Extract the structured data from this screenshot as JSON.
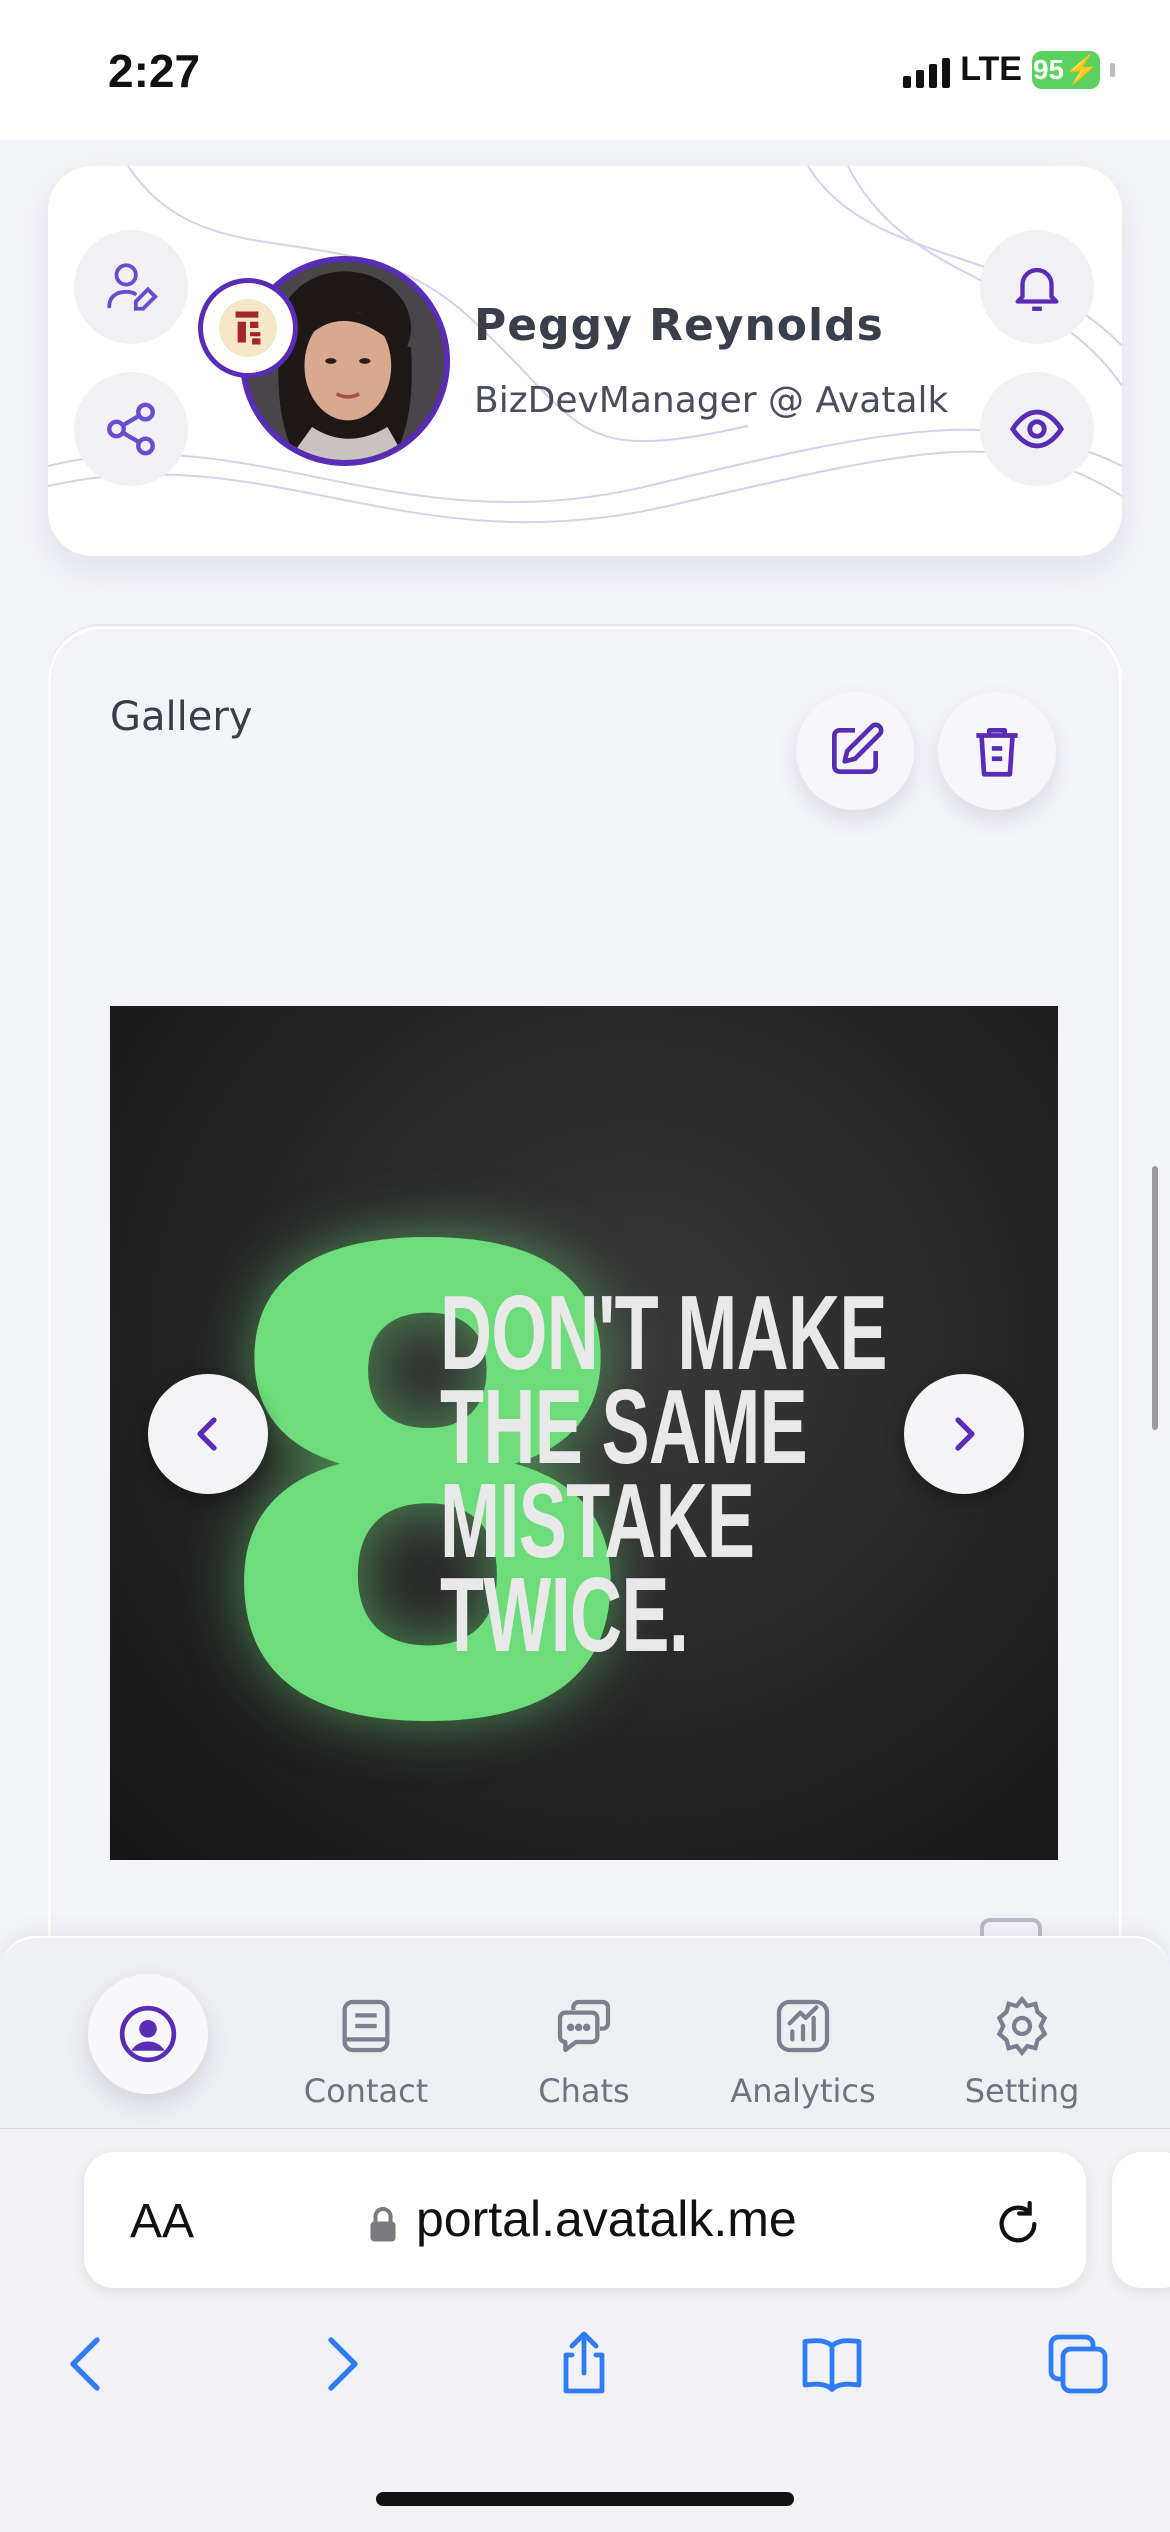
{
  "status_bar": {
    "time": "2:27",
    "network": "LTE",
    "battery": "95"
  },
  "profile": {
    "name": "Peggy Reynolds",
    "title": "BizDevManager @ Avatalk",
    "icons": [
      "user-edit-icon",
      "share-icon",
      "bell-icon",
      "eye-icon"
    ]
  },
  "gallery": {
    "title": "Gallery",
    "slide": {
      "big_number": "8",
      "lines": [
        "DON'T MAKE",
        "THE SAME",
        "MISTAKE",
        "TWICE."
      ]
    }
  },
  "bottom_nav": {
    "items": [
      {
        "label": "",
        "icon": "profile-icon",
        "active": true
      },
      {
        "label": "Contact",
        "icon": "contact-book-icon"
      },
      {
        "label": "Chats",
        "icon": "chat-bubbles-icon"
      },
      {
        "label": "Analytics",
        "icon": "analytics-chart-icon"
      },
      {
        "label": "Setting",
        "icon": "gear-icon"
      }
    ]
  },
  "browser": {
    "text_size_label": "AA",
    "url": "portal.avatalk.me"
  },
  "colors": {
    "accent": "#5a2bb5",
    "slide_green": "#6ddc7a",
    "browser_blue": "#2f7cf6"
  }
}
